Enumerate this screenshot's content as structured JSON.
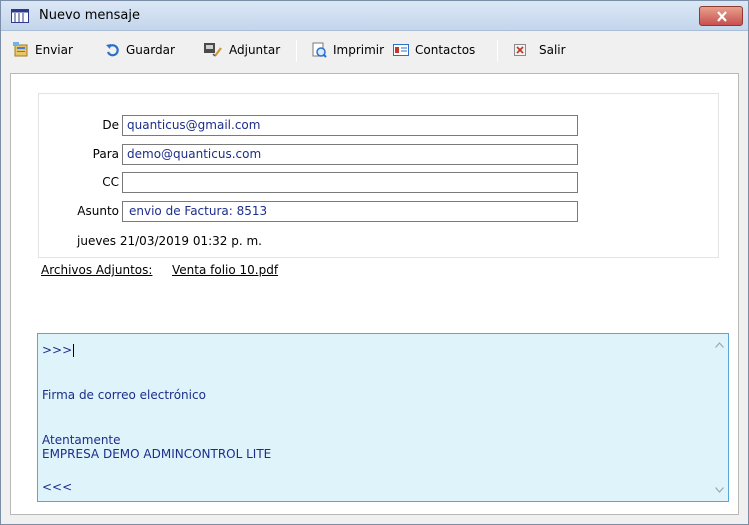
{
  "window": {
    "title": "Nuevo mensaje"
  },
  "toolbar": {
    "send_label": "Enviar",
    "save_label": "Guardar",
    "attach_label": "Adjuntar",
    "print_label": "Imprimir",
    "contacts_label": "Contactos",
    "exit_label": "Salir"
  },
  "form": {
    "from_label": "De",
    "from_value": "quanticus@gmail.com",
    "to_label": "Para",
    "to_value": "demo@quanticus.com",
    "cc_label": "CC",
    "cc_value": "",
    "subject_label": "Asunto",
    "subject_value": "envio de Factura: 8513",
    "date": "jueves 21/03/2019 01:32 p. m."
  },
  "attachments": {
    "label": "Archivos Adjuntos:",
    "file": "Venta folio 10.pdf"
  },
  "body": {
    "line1": ">>>",
    "signature_title": "Firma de correo electrónico",
    "closing": "Atentamente",
    "company": "EMPRESA DEMO ADMINCONTROL LITE",
    "end_marker": "<<<"
  },
  "colors": {
    "body_background": "#dff3fb",
    "body_border": "#5aa7d6",
    "field_text": "#1c2e8a",
    "close_button": "#c75050"
  },
  "icons": [
    "window-icon",
    "close-icon",
    "send-icon",
    "save-icon",
    "attach-icon",
    "print-icon",
    "contacts-icon",
    "exit-icon",
    "scroll-up-icon",
    "scroll-down-icon"
  ]
}
